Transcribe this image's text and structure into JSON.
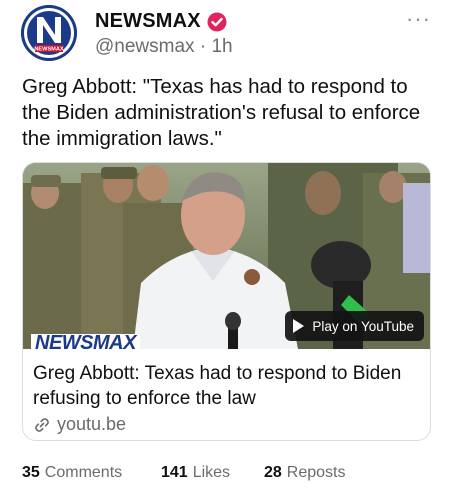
{
  "author": {
    "display_name": "NEWSMAX",
    "handle": "@newsmax",
    "separator": "·",
    "time_ago": "1h",
    "avatar_text": "NEWSMAX",
    "avatar_letter": "N",
    "verified_color": "#e0245e",
    "brand_color": "#1b3a8a",
    "more_icon": "more-horizontal-icon",
    "more_label": "···"
  },
  "post": {
    "text": "Greg Abbott: \"Texas has had to respond to the Biden administration's refusal to enforce the immigration laws.\""
  },
  "link_card": {
    "title": "Greg Abbott: Texas had to respond to Biden refusing to enforce the law",
    "domain": "youtu.be",
    "play_label": "Play on YouTube",
    "watermark": "NEWSMAX",
    "link_icon": "link-icon",
    "play_icon": "play-icon"
  },
  "stats": {
    "comments_count": "35",
    "comments_label": "Comments",
    "likes_count": "141",
    "likes_label": "Likes",
    "reposts_count": "28",
    "reposts_label": "Reposts"
  }
}
